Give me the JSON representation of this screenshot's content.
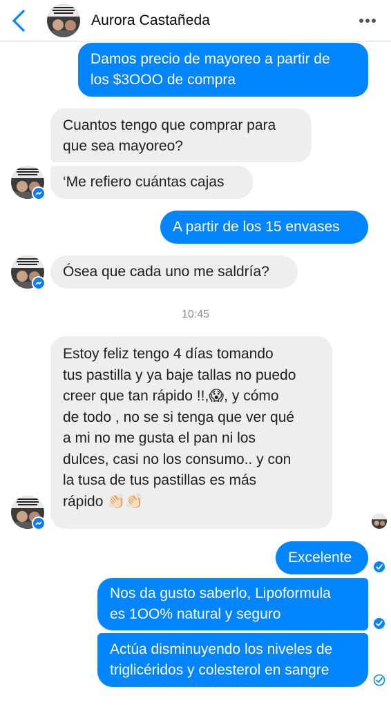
{
  "header": {
    "contact_name": "Aurora Castañeda",
    "back_icon": "chevron-left-icon",
    "more_icon": "more-horizontal-icon"
  },
  "colors": {
    "accent": "#0084ff",
    "incoming_bubble": "#eeeeee",
    "timestamp": "#8a8d91"
  },
  "messages": [
    {
      "direction": "out",
      "lines": [
        "Damos precio de mayoreo a partir de",
        "los $3OOO de compra"
      ]
    },
    {
      "direction": "in",
      "lines": [
        "Cuantos tengo que comprar para",
        "que sea mayoreo?"
      ]
    },
    {
      "direction": "in",
      "lines": [
        "‘Me refiero cuántas cajas"
      ]
    },
    {
      "direction": "out",
      "lines": [
        "A partir de los 15 envases"
      ]
    },
    {
      "direction": "in",
      "lines": [
        "Ósea que cada uno me saldría?"
      ]
    },
    {
      "direction": "in",
      "lines": [
        "Estoy feliz tengo 4 días tomando",
        "tus pastilla y ya baje tallas no puedo",
        "creer que tan rápido !!,😱, y cómo",
        "de todo , no se si tenga que ver qué",
        "a mi no me gusta el pan ni los",
        "dulces, casi no los consumo.. y con",
        "la tusa de tus pastillas es más",
        "rápido 👏🏻👏🏻"
      ]
    },
    {
      "direction": "out",
      "lines": [
        "Excelente"
      ]
    },
    {
      "direction": "out",
      "lines": [
        "Nos da gusto saberlo, Lipoformula",
        "es 1OO% natural y seguro"
      ]
    },
    {
      "direction": "out",
      "lines": [
        "Actúa disminuyendo los niveles de",
        "triglicéridos y colesterol en sangre"
      ]
    }
  ],
  "timestamp": "10:45"
}
